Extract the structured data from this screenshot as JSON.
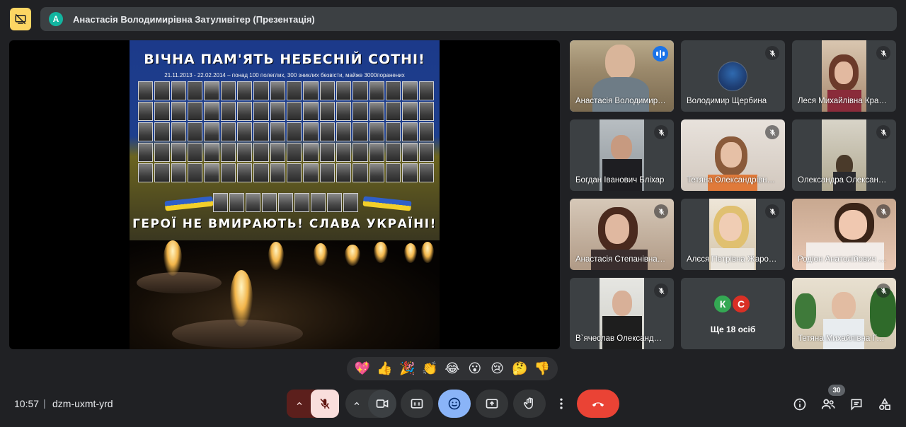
{
  "header": {
    "presenter_avatar_letter": "А",
    "presenter_title": "Анастасія Володимирівна Затуливітер (Презентація)"
  },
  "slide": {
    "title": "ВІЧНА ПАМ'ЯТЬ НЕБЕСНІЙ СОТНІ!",
    "subtitle": "21.11.2013 - 22.02.2014 – понад 100 полеглих, 300 зниклих безвісти, майже 3000поранених",
    "footer": "ГЕРОЇ НЕ ВМИРАЮТЬ! СЛАВА УКРАЇНІ!"
  },
  "participants": [
    {
      "name": "Анастасія Володимирівна Затуливітер",
      "speaking": true
    },
    {
      "name": "Володимир Щербина",
      "muted": true
    },
    {
      "name": "Леся Михайлівна Кравчук",
      "muted": true
    },
    {
      "name": "Богдан Іванович Бліхар",
      "muted": true
    },
    {
      "name": "Тетяна Олександрівна Костенко",
      "muted": true
    },
    {
      "name": "Олександра Олександрівна Бойко",
      "muted": true
    },
    {
      "name": "Анастасія Степанівна Мельник",
      "muted": true
    },
    {
      "name": "Алєся Петрівна Жаровська",
      "muted": true
    },
    {
      "name": "Родіон Анатолійович Савчук",
      "muted": true
    },
    {
      "name": "В`ячеслав Олександрович Кравець",
      "muted": true
    },
    {
      "name": "Тетяна Михайлівна Гончар",
      "muted": true
    }
  ],
  "more_tile": {
    "avatars": [
      {
        "letter": "К",
        "color": "#34a853"
      },
      {
        "letter": "С",
        "color": "#d93025"
      }
    ],
    "label": "Ще 18 осіб"
  },
  "reactions": [
    "💖",
    "👍",
    "🎉",
    "👏",
    "😂",
    "😮",
    "😢",
    "🤔",
    "👎"
  ],
  "bottom_bar": {
    "time": "10:57",
    "separator": "|",
    "meeting_code": "dzm-uxmt-yrd",
    "people_count": "30"
  },
  "colors": {
    "background": "#202124",
    "tile": "#3c4043",
    "accent_blue": "#8ab4f8",
    "end_call_red": "#ea4335",
    "mic_muted_bg": "#f9dedc",
    "present_yellow": "#fdd663"
  },
  "icons": {
    "present": "presentation-off-icon",
    "mute": "mic-off-icon",
    "speaking": "audio-wave-icon",
    "camera": "videocam-icon",
    "captions": "closed-caption-icon",
    "emoji": "emoji-icon",
    "present_now": "present-to-all-icon",
    "raise_hand": "hand-icon",
    "more": "more-vert-icon",
    "end_call": "call-end-icon",
    "info": "info-icon",
    "people": "people-icon",
    "chat": "chat-icon",
    "activities": "activities-icon"
  }
}
